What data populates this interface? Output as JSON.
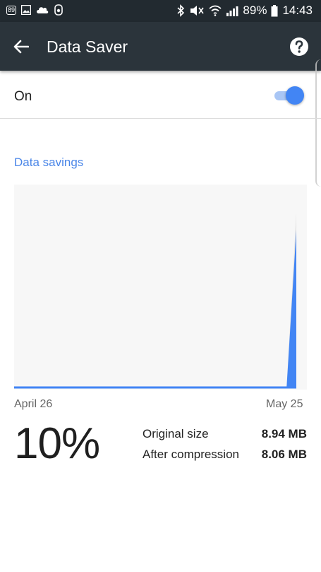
{
  "status_bar": {
    "badge": "89",
    "battery_text": "89%",
    "time": "14:43",
    "icons": [
      "notification-badge-icon",
      "image-icon",
      "cloud-icon",
      "app-icon",
      "bluetooth-icon",
      "mute-icon",
      "wifi-icon",
      "signal-icon",
      "battery-icon"
    ]
  },
  "toolbar": {
    "title": "Data Saver",
    "back_icon": "arrow-left-icon",
    "help_icon": "help-circle-icon"
  },
  "toggle": {
    "label": "On",
    "state": true,
    "accent": "#4285f4"
  },
  "section": {
    "title": "Data savings"
  },
  "chart_data": {
    "type": "area",
    "x_start_label": "April 26",
    "x_end_label": "May 25",
    "series": [
      {
        "values": [
          0,
          0,
          0,
          0,
          0,
          0,
          0,
          0,
          0,
          0,
          0,
          0,
          0,
          0,
          0,
          0,
          0,
          0,
          0,
          0,
          0,
          0,
          0,
          0,
          0,
          0,
          0,
          0,
          0,
          8.94
        ]
      },
      {
        "values": [
          0,
          0,
          0,
          0,
          0,
          0,
          0,
          0,
          0,
          0,
          0,
          0,
          0,
          0,
          0,
          0,
          0,
          0,
          0,
          0,
          0,
          0,
          0,
          0,
          0,
          0,
          0,
          0,
          0,
          8.06
        ]
      }
    ],
    "colors": {
      "original": "#e0e0e0",
      "compressed": "#4285f4",
      "background": "#f7f7f7"
    }
  },
  "stats": {
    "percent": "10%",
    "original_label": "Original size",
    "original_value": "8.94 MB",
    "compressed_label": "After compression",
    "compressed_value": "8.06 MB"
  }
}
